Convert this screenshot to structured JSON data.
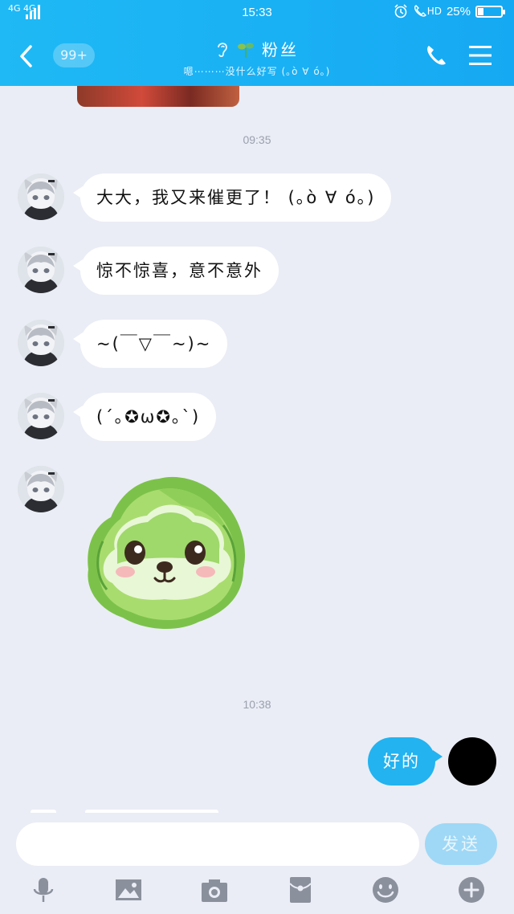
{
  "status": {
    "network": "4G 4G",
    "time": "15:33",
    "hd": "HD",
    "battery": "25%",
    "battery_level": 0.25,
    "icons": [
      "signal-icon",
      "alarm-icon",
      "call-hd-icon",
      "battery-icon"
    ]
  },
  "header": {
    "back_icon": "chevron-left-icon",
    "unread_badge": "99+",
    "title_prefix_icons": [
      "ear-icon",
      "sprout-icon"
    ],
    "title": "粉丝",
    "subtitle": "嗯⋯⋯⋯没什么好写 (｡ò ∀ ó｡)",
    "phone_icon": "phone-icon",
    "menu_icon": "menu-icon"
  },
  "messages": {
    "time1": "09:35",
    "incoming": [
      {
        "text": "大大，我又来催更了！ (｡ò ∀ ó｡)"
      },
      {
        "text": "惊不惊喜，意不意外"
      },
      {
        "text": "~(￣▽￣~)~"
      },
      {
        "text": "(´｡✪ω✪｡`)"
      }
    ],
    "sticker": "cabbage-dog-sticker",
    "time2": "10:38",
    "outgoing": [
      {
        "text": "好的"
      }
    ]
  },
  "composer": {
    "input_value": "",
    "send_label": "发送",
    "toolbar_icons": [
      "microphone-icon",
      "image-icon",
      "camera-icon",
      "red-packet-icon",
      "emoji-icon",
      "plus-icon"
    ]
  },
  "colors": {
    "header": "#16a9f3",
    "outgoing_bubble": "#22b3f0",
    "background": "#eaedf5",
    "send_button": "#9fd8f6"
  }
}
